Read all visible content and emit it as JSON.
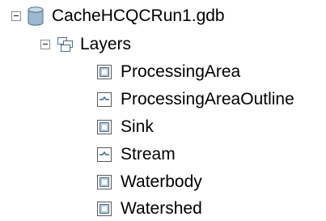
{
  "tree": {
    "root": {
      "label": "CacheHCQCRun1.gdb",
      "expanded": true,
      "icon": "database-icon"
    },
    "group": {
      "label": "Layers",
      "expanded": true,
      "icon": "layers-icon"
    },
    "items": [
      {
        "label": "ProcessingArea",
        "icon": "polygon-layer-icon"
      },
      {
        "label": "ProcessingAreaOutline",
        "icon": "line-layer-icon"
      },
      {
        "label": "Sink",
        "icon": "polygon-layer-icon"
      },
      {
        "label": "Stream",
        "icon": "line-layer-icon"
      },
      {
        "label": "Waterbody",
        "icon": "polygon-layer-icon"
      },
      {
        "label": "Watershed",
        "icon": "polygon-layer-icon"
      }
    ]
  },
  "colors": {
    "database": "#8fb0c8",
    "icon_border": "#4a6a88",
    "expander_border": "#8c8c8c"
  }
}
